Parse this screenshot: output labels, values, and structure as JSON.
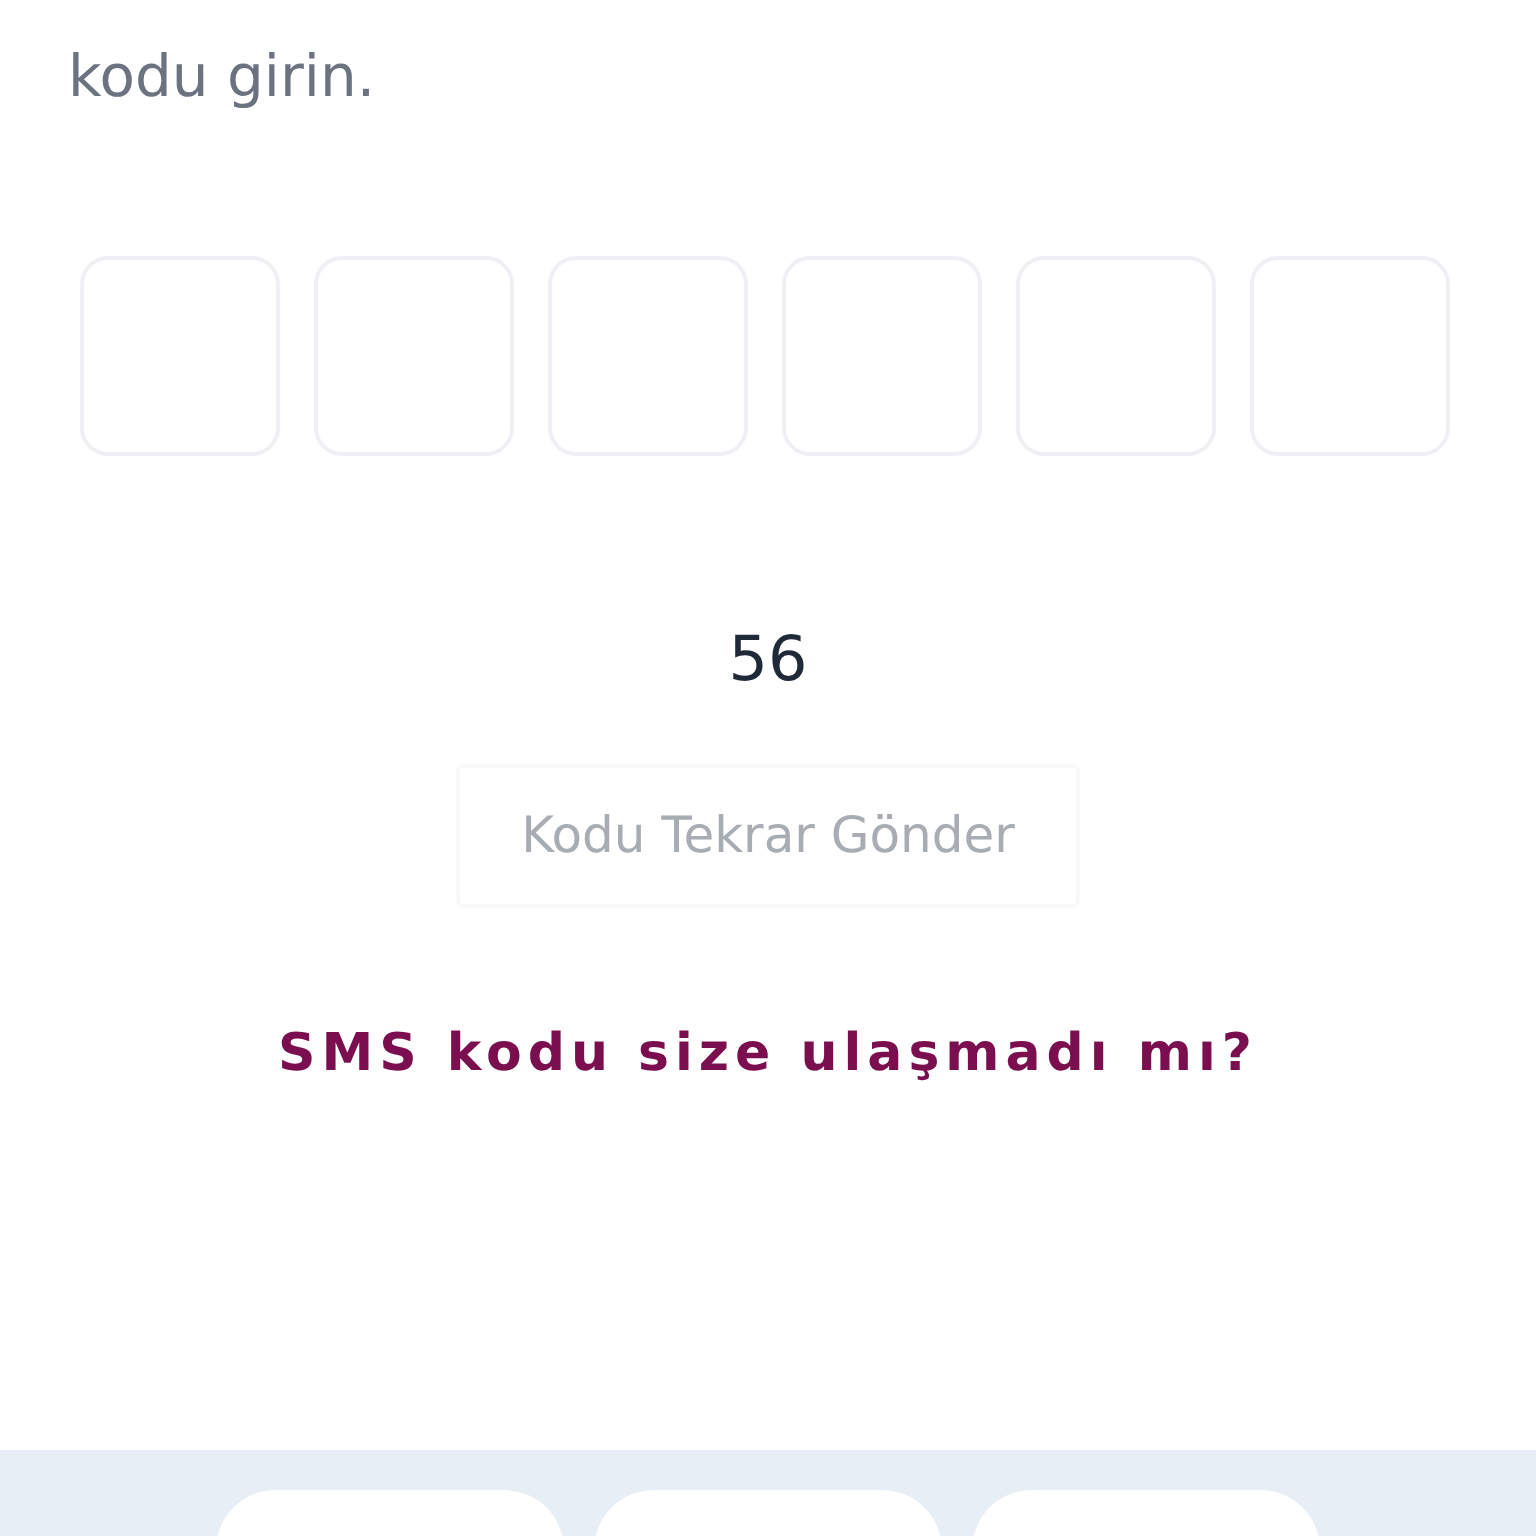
{
  "instruction": "kodu girin.",
  "code_boxes": [
    {
      "filled": false
    },
    {
      "filled": false
    },
    {
      "filled": false
    },
    {
      "filled": false
    },
    {
      "filled": false
    },
    {
      "filled": false
    }
  ],
  "timer": "56",
  "resend_button": {
    "label": "Kodu Tekrar Gönder",
    "disabled": true
  },
  "help_link": "SMS kodu size ulaşmadı mı?"
}
